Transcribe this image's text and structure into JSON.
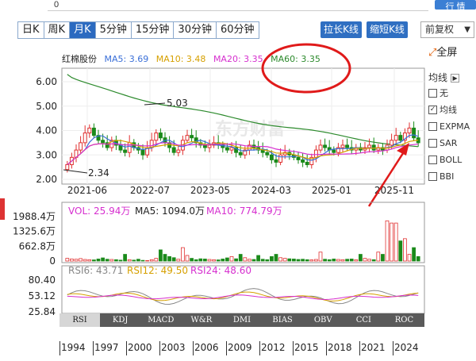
{
  "top": {
    "zero": "0",
    "right_button": "行 情"
  },
  "tabs": [
    {
      "label": "日K",
      "active": false
    },
    {
      "label": "周K",
      "active": false
    },
    {
      "label": "月K",
      "active": true
    },
    {
      "label": "5分钟",
      "active": false
    },
    {
      "label": "15分钟",
      "active": false
    },
    {
      "label": "30分钟",
      "active": false
    },
    {
      "label": "60分钟",
      "active": false
    }
  ],
  "toolbar": {
    "stretch_label": "拉长K线",
    "shrink_label": "缩短K线",
    "fq_label": "前复权",
    "fullscreen_label": "全屏"
  },
  "legend": {
    "name": "红棉股份",
    "ma5": "MA5: 3.69",
    "ma10": "MA10: 3.48",
    "ma20": "MA20: 3.35",
    "ma60": "MA60: 3.35"
  },
  "colors": {
    "ma5": "#3a6fd8",
    "ma10": "#d6a000",
    "ma20": "#d62fcf",
    "ma60": "#2c8a2c",
    "up": "#e03030",
    "down": "#1a8a1a",
    "circle": "#e01a1a",
    "arrow": "#e01a1a"
  },
  "side": {
    "title": "均线",
    "items": [
      {
        "label": "无",
        "checked": false
      },
      {
        "label": "均线",
        "checked": true
      },
      {
        "label": "EXPMA",
        "checked": false
      },
      {
        "label": "SAR",
        "checked": false
      },
      {
        "label": "BOLL",
        "checked": false
      },
      {
        "label": "BBI",
        "checked": false
      }
    ]
  },
  "price_chart": {
    "y_ticks": [
      "6.00",
      "5.00",
      "4.00",
      "3.00",
      "2.00"
    ],
    "x_ticks": [
      "2021-06",
      "2022-07",
      "2023-05",
      "2024-03",
      "2025-01",
      "2025-11"
    ],
    "annot_high": "5.03",
    "annot_low": "2.34",
    "watermark": "东方财富"
  },
  "volume_chart": {
    "legend": {
      "vol": "VOL: 25.94万",
      "ma5": "MA5: 1094.0万",
      "ma10": "MA10: 774.79万"
    },
    "y_ticks": [
      "1988.4万",
      "1325.6万",
      "662.8万",
      "0"
    ]
  },
  "rsi_chart": {
    "legend": {
      "rsi6": "RSI6: 43.71",
      "rsi12": "RSI12: 49.50",
      "rsi24": "RSI24: 48.60"
    },
    "y_ticks": [
      "80.40",
      "53.12",
      "25.84"
    ]
  },
  "indicator_tabs": [
    "RSI",
    "KDJ",
    "MACD",
    "W&R",
    "DMI",
    "BIAS",
    "OBV",
    "CCI",
    "ROC"
  ],
  "years": [
    "1994",
    "1997",
    "2000",
    "2003",
    "2006",
    "2009",
    "2012",
    "2015",
    "2018",
    "2021",
    "2024"
  ]
}
